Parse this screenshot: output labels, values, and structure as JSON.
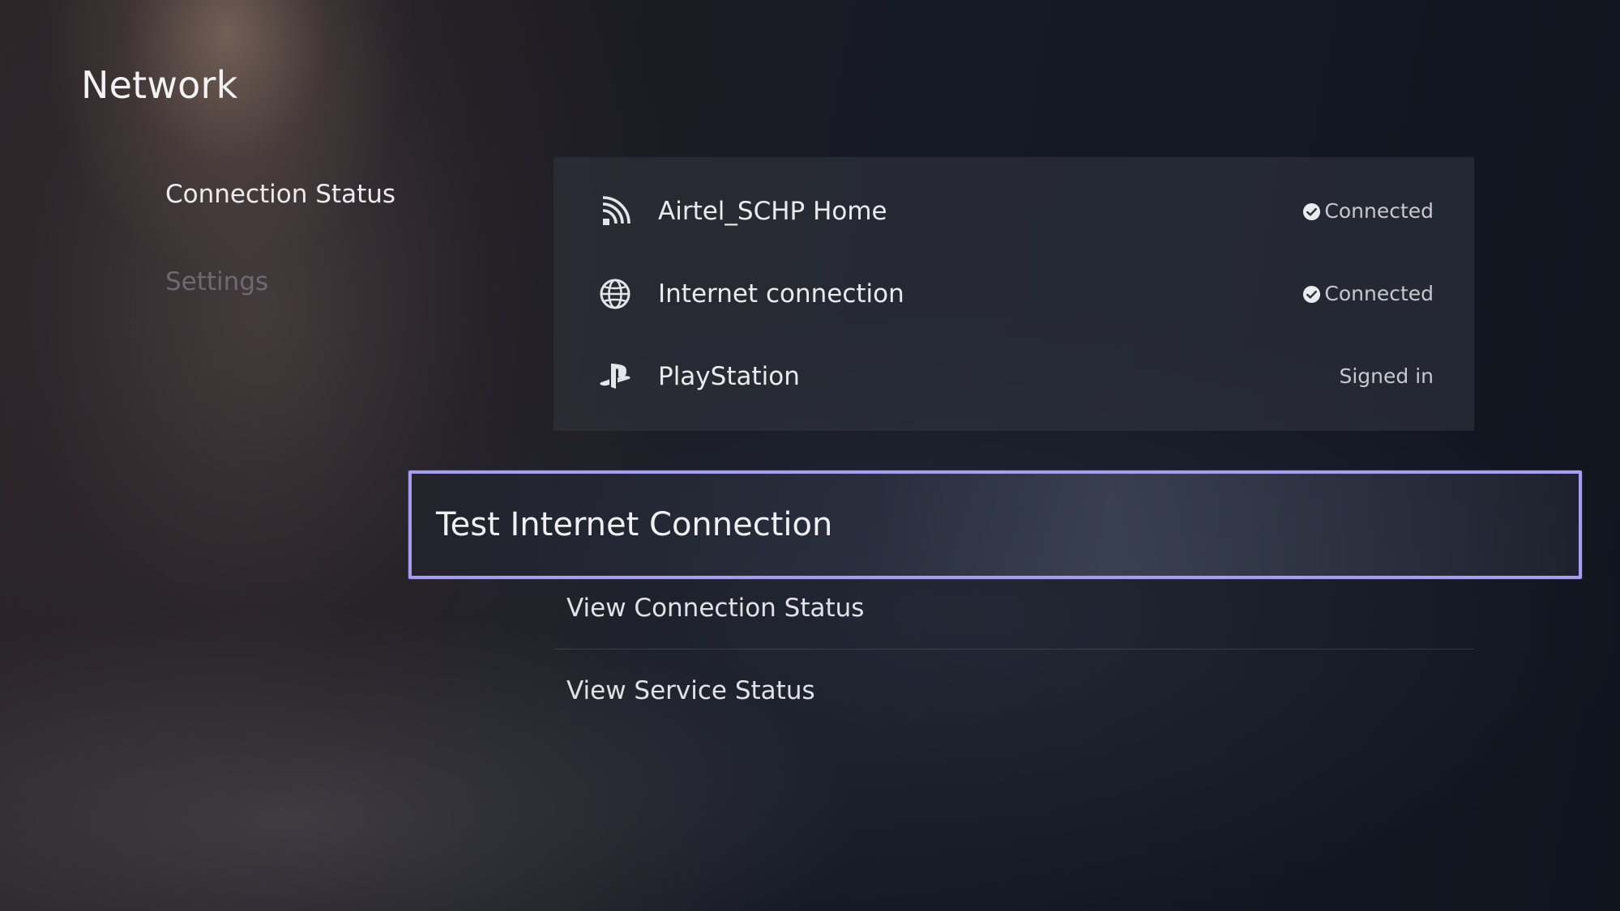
{
  "page": {
    "title": "Network"
  },
  "side_menu": {
    "items": [
      {
        "label": "Connection Status",
        "state": "selected"
      },
      {
        "label": "Settings",
        "state": "unfocused"
      }
    ]
  },
  "status_panel": {
    "rows": [
      {
        "icon": "wifi-icon",
        "label": "Airtel_SCHP Home",
        "value": "Connected",
        "status_icon": "check-circle-icon"
      },
      {
        "icon": "globe-icon",
        "label": "Internet connection",
        "value": "Connected",
        "status_icon": "check-circle-icon"
      },
      {
        "icon": "playstation-icon",
        "label": "PlayStation",
        "value": "Signed in"
      }
    ]
  },
  "actions": {
    "focused": {
      "label": "Test Internet Connection"
    },
    "items": [
      {
        "label": "View Connection Status"
      },
      {
        "label": "View Service Status"
      }
    ]
  },
  "colors": {
    "focus_outline": "#a79df0",
    "text_primary": "#ebebef",
    "text_dim": "#6d6a72"
  }
}
